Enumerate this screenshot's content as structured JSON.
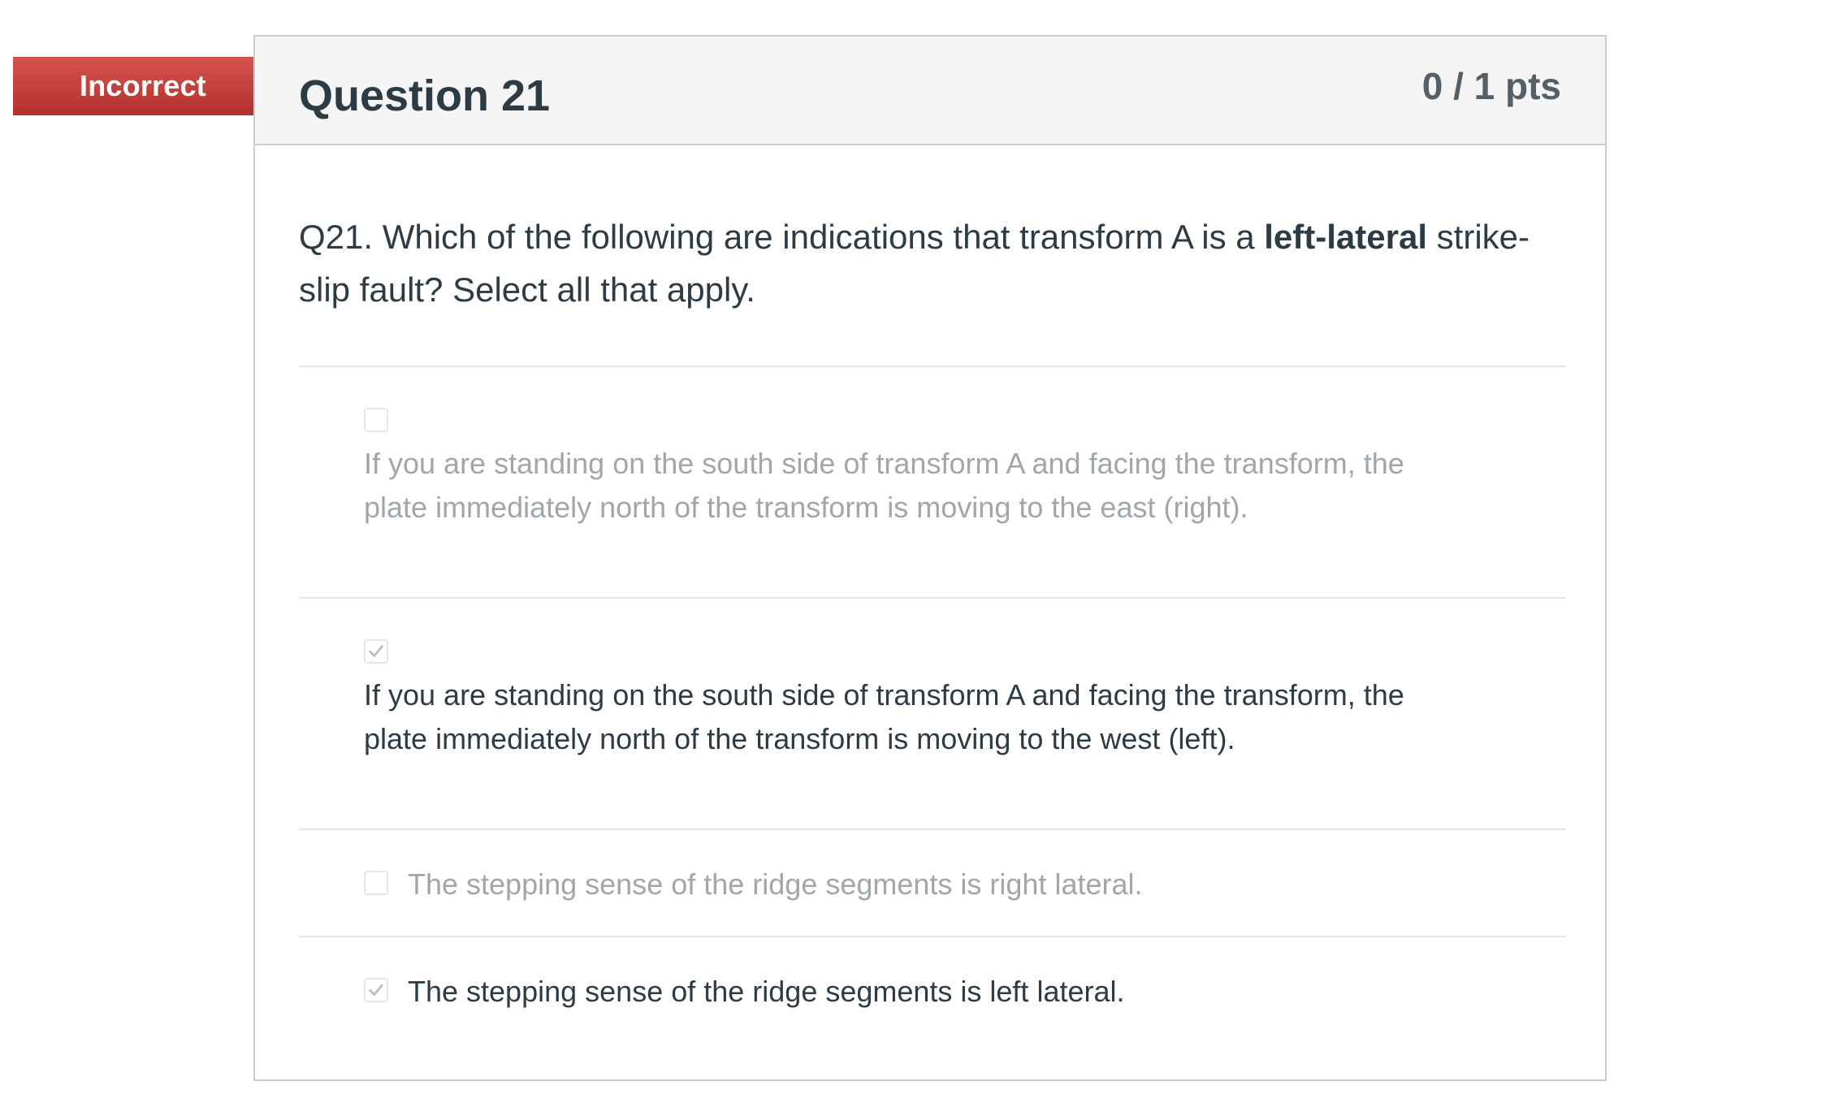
{
  "status_badge": "Incorrect",
  "question": {
    "title": "Question 21",
    "points": "0 / 1 pts",
    "text_before": "Q21. Which of the following are indications that transform A is a ",
    "text_bold": "left-lateral",
    "text_after": " strike-slip fault? Select all that apply."
  },
  "answers": [
    {
      "text": "If you are standing on the south side of transform A and facing the transform, the plate immediately north of the transform is moving to the east (right).",
      "checked": false
    },
    {
      "text": "If you are standing on the south side of transform A and facing the transform, the plate immediately north of the transform is moving to the west (left).",
      "checked": true
    },
    {
      "text": "The stepping sense of the ridge segments is right lateral.",
      "checked": false
    },
    {
      "text": "The stepping sense of the ridge segments is left lateral.",
      "checked": true
    }
  ],
  "colors": {
    "incorrect_banner": "#c0392b",
    "text": "#2d3b45",
    "muted_text": "#a0a6aa",
    "header_bg": "#f5f5f5",
    "border": "#c7cdd1"
  },
  "icons": {
    "checkmark": "check-icon"
  }
}
